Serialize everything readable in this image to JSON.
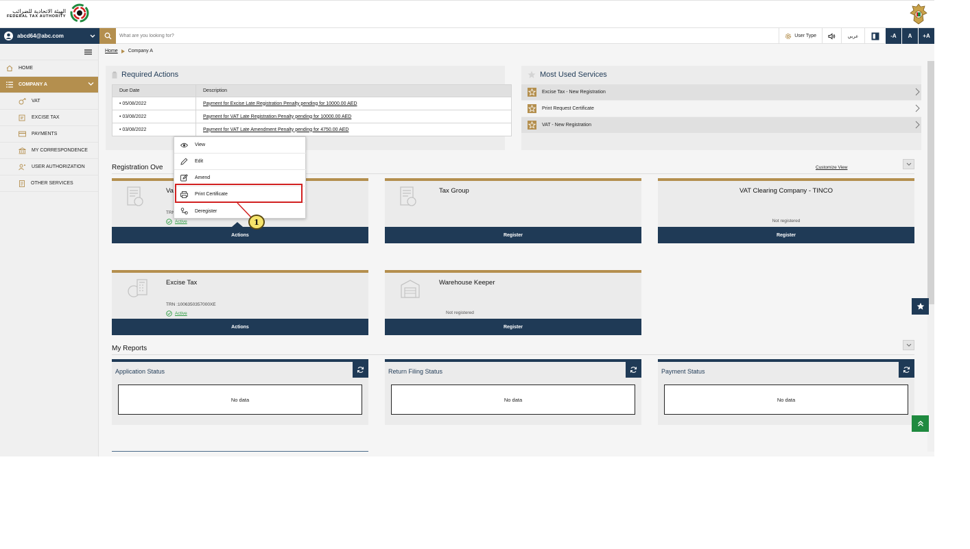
{
  "brand": {
    "name_ar": "الهيئة الاتحادية للضرائب",
    "name_en": "FEDERAL TAX AUTHORITY"
  },
  "header": {
    "user_email": "abcd64@abc.com",
    "search_placeholder": "What are you looking for?",
    "user_type_label": "User Type",
    "language_label": "عربي",
    "font_decrease": "-A",
    "font_normal": "A",
    "font_increase": "+A"
  },
  "sidebar": {
    "items": [
      {
        "label": "HOME",
        "icon": "home-icon"
      },
      {
        "label": "COMPANY A",
        "icon": "grid-icon"
      },
      {
        "label": "VAT",
        "icon": "vat-icon"
      },
      {
        "label": "EXCISE TAX",
        "icon": "excise-icon"
      },
      {
        "label": "PAYMENTS",
        "icon": "payments-icon"
      },
      {
        "label": "MY CORRESPONDENCE",
        "icon": "bank-icon"
      },
      {
        "label": "USER AUTHORIZATION",
        "icon": "user-auth-icon"
      },
      {
        "label": "OTHER SERVICES",
        "icon": "document-icon"
      }
    ]
  },
  "breadcrumb": {
    "home": "Home",
    "current": "Company A"
  },
  "required_actions": {
    "title": "Required Actions",
    "columns": [
      "Due Date",
      "Description"
    ],
    "rows": [
      {
        "date": "• 05/08/2022",
        "description": "Payment for Excise Late Registration Penalty pending for 10000.00 AED"
      },
      {
        "date": "• 03/08/2022",
        "description": "Payment for VAT Late Registration Penalty pending for 10000.00 AED"
      },
      {
        "date": "• 03/08/2022",
        "description": "Payment for VAT Late Amendment Penalty pending for 4750.00 AED"
      }
    ]
  },
  "most_used": {
    "title": "Most Used Services",
    "items": [
      "Excise Tax - New Registration",
      "Print Request Certificate",
      "VAT - New Registration"
    ]
  },
  "registration": {
    "title": "Registration Ove",
    "customize": "Customize View",
    "tiles": [
      {
        "title": "Va",
        "trn": "TRN",
        "status": "Active",
        "button": "Actions"
      },
      {
        "title": "Tax Group",
        "button": "Register"
      },
      {
        "title": "VAT Clearing Company - TINCO",
        "status_text": "Not registered",
        "button": "Register"
      },
      {
        "title": "Excise Tax",
        "trn": "TRN :1006350357000XE",
        "status": "Active",
        "button": "Actions"
      },
      {
        "title": "Warehouse Keeper",
        "status_text": "Not registered",
        "button": "Register"
      }
    ]
  },
  "context_menu": {
    "items": [
      {
        "label": "View",
        "icon": "eye-icon"
      },
      {
        "label": "Edit",
        "icon": "pencil-icon"
      },
      {
        "label": "Amend",
        "icon": "amend-icon"
      },
      {
        "label": "Print Certificate",
        "icon": "printer-icon"
      },
      {
        "label": "Deregister",
        "icon": "deregister-icon"
      }
    ],
    "callout": "1"
  },
  "reports": {
    "title": "My Reports",
    "items": [
      {
        "title": "Application Status",
        "empty": "No data"
      },
      {
        "title": "Return Filing Status",
        "empty": "No data"
      },
      {
        "title": "Payment Status",
        "empty": "No data"
      }
    ]
  },
  "colors": {
    "navy": "#1f3a56",
    "gold": "#b48f4e",
    "active_green": "#2f9e44",
    "highlight_red": "#d11f1f",
    "callout_yellow": "#f6e46a"
  }
}
